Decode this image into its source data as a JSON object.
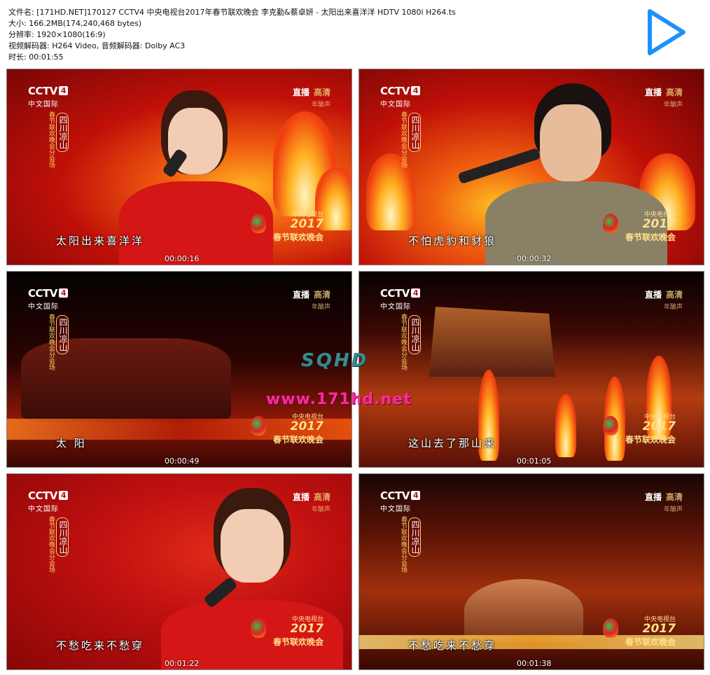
{
  "info": {
    "filename_label": "文件名:",
    "filename": "[171HD.NET]170127 CCTV4 中央电视台2017年春节联欢晚会 李克勤&蔡卓妍 - 太阳出来喜洋洋 HDTV 1080i H264.ts",
    "size_label": "大小:",
    "size": "166.2MB(174,240,468 bytes)",
    "resolution_label": "分辨率:",
    "resolution": "1920×1080(16:9)",
    "codec_label": "视频解码器:",
    "codec": "H264 Video, 音频解码器: Dolby AC3",
    "duration_label": "时长:",
    "duration": "00:01:55"
  },
  "play_icon": "play-icon",
  "overlay": {
    "channel": "CCTV",
    "channel_num": "4",
    "channel_sub": "中文国际",
    "live": "直播",
    "hd": "高清",
    "nianyesheng": "年酿声",
    "venue_tall": "春节联欢晚会分会场",
    "venue_loc": "四川凉山",
    "gala_ct": "中央电视台",
    "gala_year": "2017",
    "gala_name": "春节联欢晚会"
  },
  "watermark": {
    "brand": "SQHD",
    "url": "www.171hd.net"
  },
  "thumbnails": [
    {
      "subtitle": "太阳出来喜洋洋",
      "timestamp": "00:00:16"
    },
    {
      "subtitle": "不怕虎豹和豺狼",
      "timestamp": "00:00:32"
    },
    {
      "subtitle": "太 阳",
      "timestamp": "00:00:49"
    },
    {
      "subtitle": "这山去了那山来",
      "timestamp": "00:01:05"
    },
    {
      "subtitle": "不愁吃来不愁穿",
      "timestamp": "00:01:22"
    },
    {
      "subtitle": "不愁吃来不愁穿",
      "timestamp": "00:01:38"
    }
  ],
  "colors": {
    "play_accent": "#1e90ff",
    "subtitle": "#ffffff",
    "watermark_url": "#ff2aa0"
  }
}
